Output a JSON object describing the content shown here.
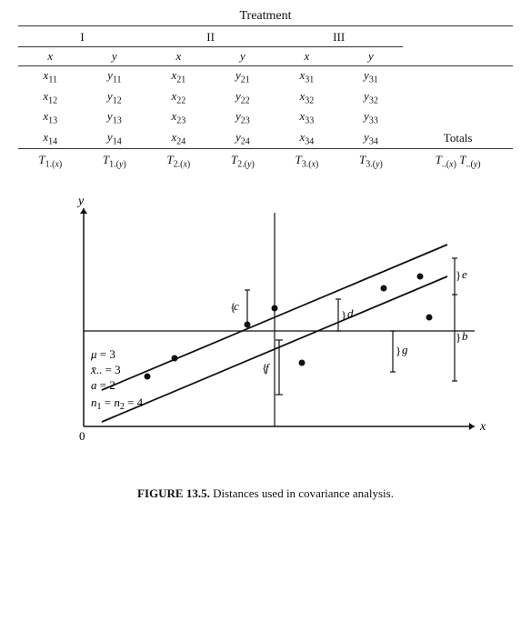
{
  "title": "Treatment",
  "groups": [
    "I",
    "II",
    "III"
  ],
  "col_headers": [
    "x",
    "y",
    "x",
    "y",
    "x",
    "y"
  ],
  "data_rows": [
    [
      "x₁₁",
      "y₁₁",
      "x₂₁",
      "y₂₁",
      "x₃₁",
      "y₃₁"
    ],
    [
      "x₁₂",
      "y₁₂",
      "x₂₂",
      "y₂₂",
      "x₃₂",
      "y₃₂"
    ],
    [
      "x₁₃",
      "y₁₃",
      "x₂₃",
      "y₂₃",
      "x₃₃",
      "y₃₃"
    ],
    [
      "x₁₄",
      "y₁₄",
      "x₂₄",
      "y₂₄",
      "x₃₄",
      "y₃₄"
    ]
  ],
  "totals_label": "Totals",
  "totals_row": [
    "T₁.(x)",
    "T₁.(y)",
    "T₂.(x)",
    "T₂.(y)",
    "T₃.(x)",
    "T₃.(y)",
    "T..(x) T..(y)"
  ],
  "figure_caption": "FIGURE 13.5.",
  "figure_caption_text": "Distances used in covariance analysis.",
  "legend": {
    "mu": "μ = 3",
    "x_bar": "x̄.. = 3",
    "a": "a = 2",
    "n": "n₁ = n₂ = 4"
  },
  "labels": {
    "c": "c",
    "d": "d",
    "e": "e",
    "f": "f",
    "g": "g",
    "b": "b",
    "y_axis": "y",
    "x_axis": "x",
    "origin": "0"
  }
}
